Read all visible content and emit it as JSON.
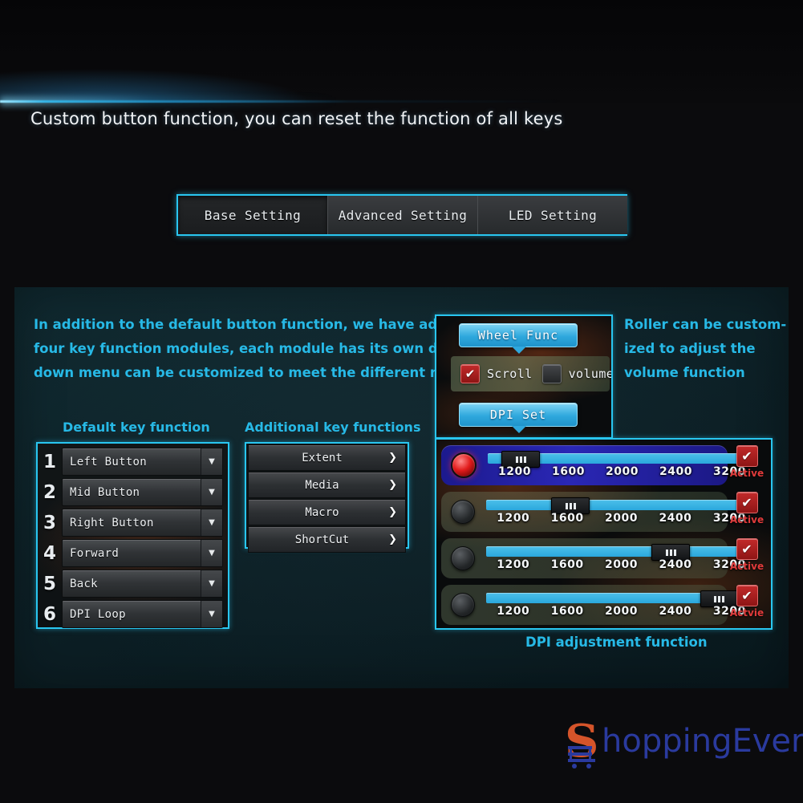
{
  "header": {
    "headline": "Custom button function, you can reset the function of all keys"
  },
  "tabs": [
    {
      "label": "Base Setting",
      "active": true
    },
    {
      "label": "Advanced Setting",
      "active": false
    },
    {
      "label": "LED Setting",
      "active": false
    }
  ],
  "description": {
    "line1": "In addition to the default button function, we have added",
    "line2": "four key function modules, each module has its own drop-",
    "line3": "down menu can be customized to meet the different needs"
  },
  "default_keys": {
    "label": "Default key function",
    "rows": [
      {
        "num": "1",
        "value": "Left Button",
        "caret": "▼"
      },
      {
        "num": "2",
        "value": "Mid Button",
        "caret": "▼"
      },
      {
        "num": "3",
        "value": "Right Button",
        "caret": "▼"
      },
      {
        "num": "4",
        "value": "Forward",
        "caret": "▼"
      },
      {
        "num": "5",
        "value": "Back",
        "caret": "▼"
      },
      {
        "num": "6",
        "value": "DPI Loop",
        "caret": "▼"
      }
    ]
  },
  "additional_keys": {
    "label": "Additional key functions",
    "items": [
      {
        "label": "Extent",
        "arrow": "❯"
      },
      {
        "label": "Media",
        "arrow": "❯"
      },
      {
        "label": "Macro",
        "arrow": "❯"
      },
      {
        "label": "ShortCut",
        "arrow": "❯"
      }
    ]
  },
  "wheel_panel": {
    "bubble_wheel": "Wheel Func",
    "bubble_dpi": "DPI Set",
    "scroll_label": "Scroll",
    "volume_label": "volume",
    "scroll_checked": true,
    "volume_checked": false,
    "check_glyph": "✔"
  },
  "roller_note": {
    "line1": "Roller can be custom-",
    "line2": "ized to adjust the",
    "line3": "volume function"
  },
  "dpi_panel": {
    "caption": "DPI adjustment function",
    "tick_labels": [
      "1200",
      "1600",
      "2000",
      "2400",
      "3200"
    ],
    "check_glyph": "✔",
    "rows": [
      {
        "selected": true,
        "led_on": true,
        "value": 1200,
        "thumb_pct": 12,
        "active_label": "Active"
      },
      {
        "selected": false,
        "led_on": false,
        "value": 1600,
        "thumb_pct": 31,
        "active_label": "Active"
      },
      {
        "selected": false,
        "led_on": false,
        "value": 2400,
        "thumb_pct": 68,
        "active_label": "Active"
      },
      {
        "selected": false,
        "led_on": false,
        "value": 3200,
        "thumb_pct": 86,
        "active_label": "Actvie"
      }
    ]
  },
  "watermark": {
    "initial": "S",
    "text": "hoppingEverydays"
  },
  "colors": {
    "accent_cyan": "#29c6f0",
    "text_cyan": "#27b9e6",
    "slider_blue": "#2aa7dd",
    "active_red": "#c22a2a",
    "selected_row": "#2a27b5"
  }
}
